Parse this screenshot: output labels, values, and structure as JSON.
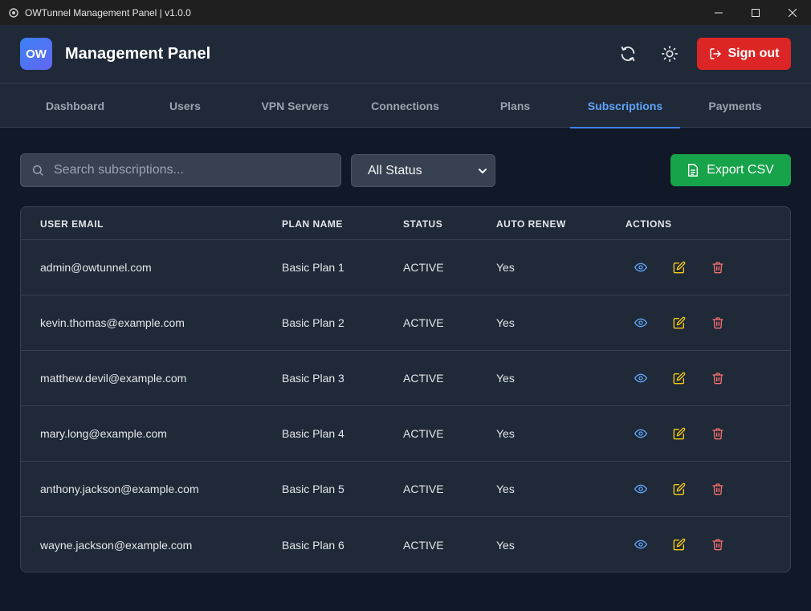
{
  "window": {
    "title": "OWTunnel Management Panel | v1.0.0"
  },
  "header": {
    "logo_text": "OW",
    "title": "Management Panel",
    "signout_label": "Sign out"
  },
  "tabs": [
    {
      "label": "Dashboard",
      "active": false
    },
    {
      "label": "Users",
      "active": false
    },
    {
      "label": "VPN Servers",
      "active": false
    },
    {
      "label": "Connections",
      "active": false
    },
    {
      "label": "Plans",
      "active": false
    },
    {
      "label": "Subscriptions",
      "active": true
    },
    {
      "label": "Payments",
      "active": false
    }
  ],
  "toolbar": {
    "search_placeholder": "Search subscriptions...",
    "status_filter": "All Status",
    "export_label": "Export CSV"
  },
  "table": {
    "headers": {
      "email": "USER EMAIL",
      "plan": "PLAN NAME",
      "status": "STATUS",
      "renew": "AUTO RENEW",
      "actions": "ACTIONS"
    },
    "rows": [
      {
        "email": "admin@owtunnel.com",
        "plan": "Basic Plan 1",
        "status": "ACTIVE",
        "renew": "Yes"
      },
      {
        "email": "kevin.thomas@example.com",
        "plan": "Basic Plan 2",
        "status": "ACTIVE",
        "renew": "Yes"
      },
      {
        "email": "matthew.devil@example.com",
        "plan": "Basic Plan 3",
        "status": "ACTIVE",
        "renew": "Yes"
      },
      {
        "email": "mary.long@example.com",
        "plan": "Basic Plan 4",
        "status": "ACTIVE",
        "renew": "Yes"
      },
      {
        "email": "anthony.jackson@example.com",
        "plan": "Basic Plan 5",
        "status": "ACTIVE",
        "renew": "Yes"
      },
      {
        "email": "wayne.jackson@example.com",
        "plan": "Basic Plan 6",
        "status": "ACTIVE",
        "renew": "Yes"
      }
    ]
  },
  "icons": {
    "view": "eye-icon",
    "edit": "edit-icon",
    "delete": "trash-icon",
    "refresh": "refresh-icon",
    "theme": "sun-icon",
    "signout": "sign-out-icon",
    "export": "file-icon",
    "search": "search-icon"
  },
  "colors": {
    "accent": "#3b82f6",
    "danger": "#dc2626",
    "success": "#16a34a",
    "view_icon": "#60a5fa",
    "edit_icon": "#facc15",
    "delete_icon": "#f87171"
  }
}
